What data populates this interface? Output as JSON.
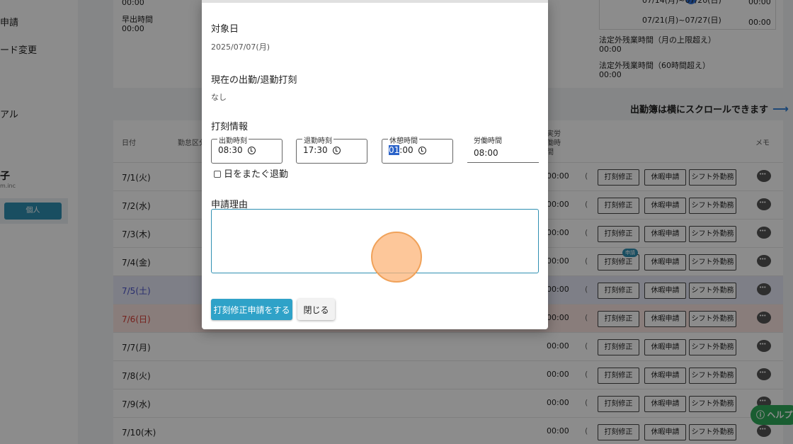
{
  "sidebar": {
    "items": [
      {
        "label": "申請"
      },
      {
        "label": "ード変更"
      },
      {
        "label": "アル"
      }
    ],
    "user_name": "子",
    "user_sub": "m.inc",
    "role_label": "個人"
  },
  "summary": {
    "top_time": "00:00",
    "early_label": "早出時間",
    "early_value": "00:00",
    "weeks": [
      {
        "range": "07/14(月)~07/20(日)",
        "value": "00:00"
      },
      {
        "range": "07/21(月)~07/27(日)",
        "value": "00:00"
      }
    ],
    "overtime_month_label": "法定外残業時間（月の上限超え）",
    "overtime_month_value": "00:00",
    "overtime_60_label": "法定外残業時間（60時間超え）",
    "overtime_60_value": "00:00"
  },
  "scroll_hint": "出勤簿は横にスクロールできます",
  "table": {
    "headers": {
      "date": "日付",
      "type": "勤怠区分",
      "work1": "実労",
      "work2": "働時",
      "work3": "間",
      "memo": "メモ"
    },
    "buttons": {
      "fix": "打刻修正",
      "leave": "休暇申請",
      "shift": "シフト外勤務",
      "badge": "申請"
    },
    "rows": [
      {
        "date": "7/1(火)",
        "time": "00:00",
        "kind": "weekday"
      },
      {
        "date": "7/2(水)",
        "time": "00:00",
        "kind": "weekday"
      },
      {
        "date": "7/3(木)",
        "time": "00:00",
        "kind": "weekday"
      },
      {
        "date": "7/4(金)",
        "time": "00:00",
        "kind": "weekday"
      },
      {
        "date": "7/5(土)",
        "time": "00:00",
        "kind": "sat"
      },
      {
        "date": "7/6(日)",
        "time": "00:00",
        "kind": "sun"
      },
      {
        "date": "7/7(月)",
        "time": "00:00",
        "kind": "weekday"
      },
      {
        "date": "7/8(火)",
        "time": "00:00",
        "kind": "weekday"
      },
      {
        "date": "7/9(水)",
        "time": "00:00",
        "kind": "weekday"
      },
      {
        "date": "7/10(木)",
        "time": "00:00",
        "kind": "weekday"
      }
    ]
  },
  "help_label": "ヘルプ",
  "modal": {
    "target_date_label": "対象日",
    "target_date_value": "2025/07/07(月)",
    "current_stamp_label": "現在の出勤/退勤打刻",
    "current_stamp_value": "なし",
    "stamp_info_label": "打刻情報",
    "clock_in_label": "出勤時刻",
    "clock_in_value": "08:30",
    "clock_out_label": "退勤時刻",
    "clock_out_value": "17:30",
    "break_label": "休憩時間",
    "break_hours": "01",
    "break_minutes": ":00",
    "work_time_label": "労働時間",
    "work_time_value": "08:00",
    "overnight_label": "日をまたぐ退勤",
    "reason_label": "申請理由",
    "reason_value": "",
    "submit_label": "打刻修正申請をする",
    "close_label": "閉じる"
  }
}
